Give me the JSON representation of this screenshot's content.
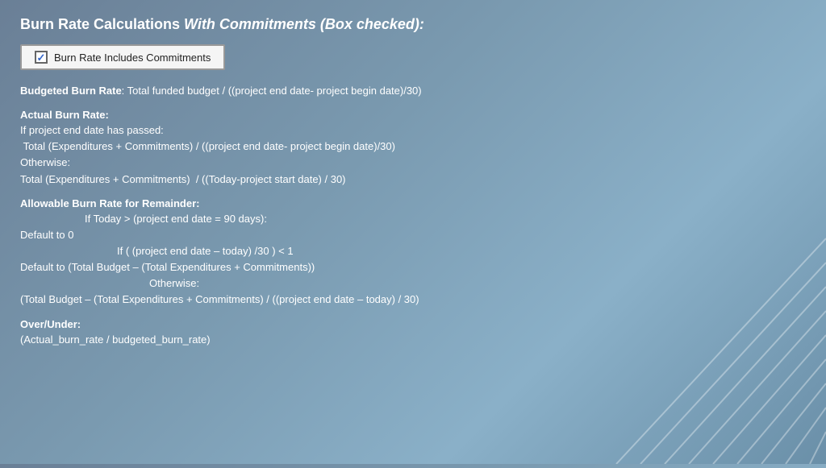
{
  "header": {
    "title_prefix": "Burn Rate Calculations ",
    "title_emphasis": "With Commitments (Box checked):"
  },
  "checkbox": {
    "label": "Burn Rate Includes Commitments",
    "checked": true
  },
  "sections": [
    {
      "id": "budgeted",
      "title": "Budgeted Burn Rate",
      "title_suffix": ": Total funded budget / ((project end date- project begin date)/30)",
      "lines": []
    },
    {
      "id": "actual",
      "title": "Actual Burn Rate:",
      "lines": [
        {
          "text": "If project end date has passed:",
          "indent": 0
        },
        {
          "text": " Total (Expenditures + Commitments) / ((project end date- project begin date)/30)",
          "indent": 0
        },
        {
          "text": "Otherwise:",
          "indent": 0
        },
        {
          "text": "Total (Expenditures + Commitments)  / ((Today-project start date) / 30)",
          "indent": 0
        }
      ]
    },
    {
      "id": "allowable",
      "title": "Allowable Burn Rate for Remainder:",
      "lines": [
        {
          "text": "If Today > (project end date = 90 days):",
          "indent": 1
        },
        {
          "text": "Default to 0",
          "indent": 0
        },
        {
          "text": "If ( (project end date – today) /30 ) < 1",
          "indent": 2
        },
        {
          "text": "Default to (Total Budget – (Total Expenditures + Commitments))",
          "indent": 0
        },
        {
          "text": "Otherwise:",
          "indent": 3
        },
        {
          "text": "(Total Budget – (Total Expenditures + Commitments) / ((project end date – today) / 30)",
          "indent": 0
        }
      ]
    },
    {
      "id": "overunder",
      "title": "Over/Under:",
      "lines": [
        {
          "text": "(Actual_burn_rate / budgeted_burn_rate)",
          "indent": 0
        }
      ]
    }
  ],
  "decorative": {
    "description": "diagonal-lines-bottom-right"
  }
}
